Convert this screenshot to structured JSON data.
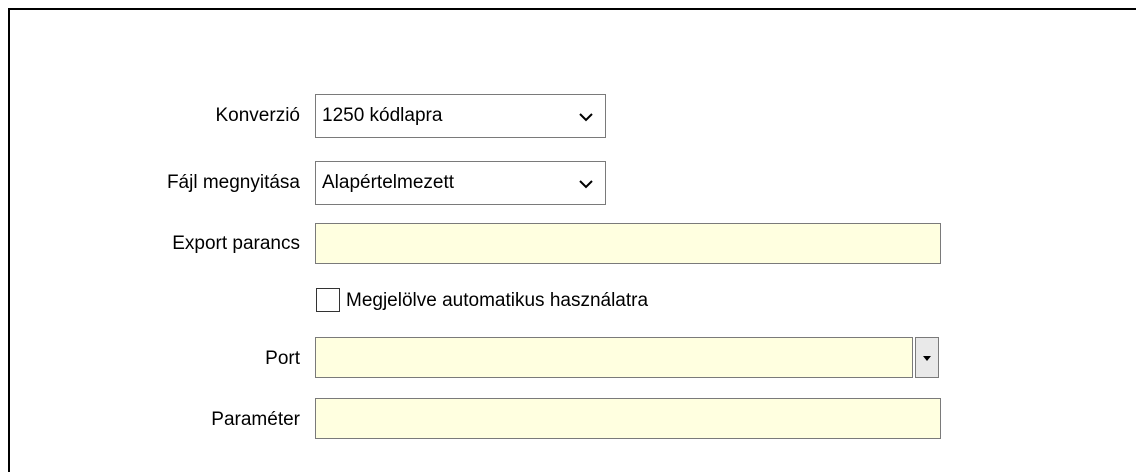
{
  "form": {
    "conversion_label": "Konverzió",
    "conversion_value": "1250 kódlapra",
    "file_open_label": "Fájl megnyitása",
    "file_open_value": "Alapértelmezett",
    "export_command_label": "Export parancs",
    "export_command_value": "",
    "auto_use_label": "Megjelölve automatikus használatra",
    "auto_use_checked": false,
    "port_label": "Port",
    "port_value": "",
    "parameter_label": "Paraméter",
    "parameter_value": ""
  },
  "icons": {
    "combo_chevron": "chevron-down-icon",
    "port_dropdown": "triangle-down-icon"
  },
  "colors": {
    "field_background": "#ffffe0",
    "border": "#7a7a7a"
  }
}
